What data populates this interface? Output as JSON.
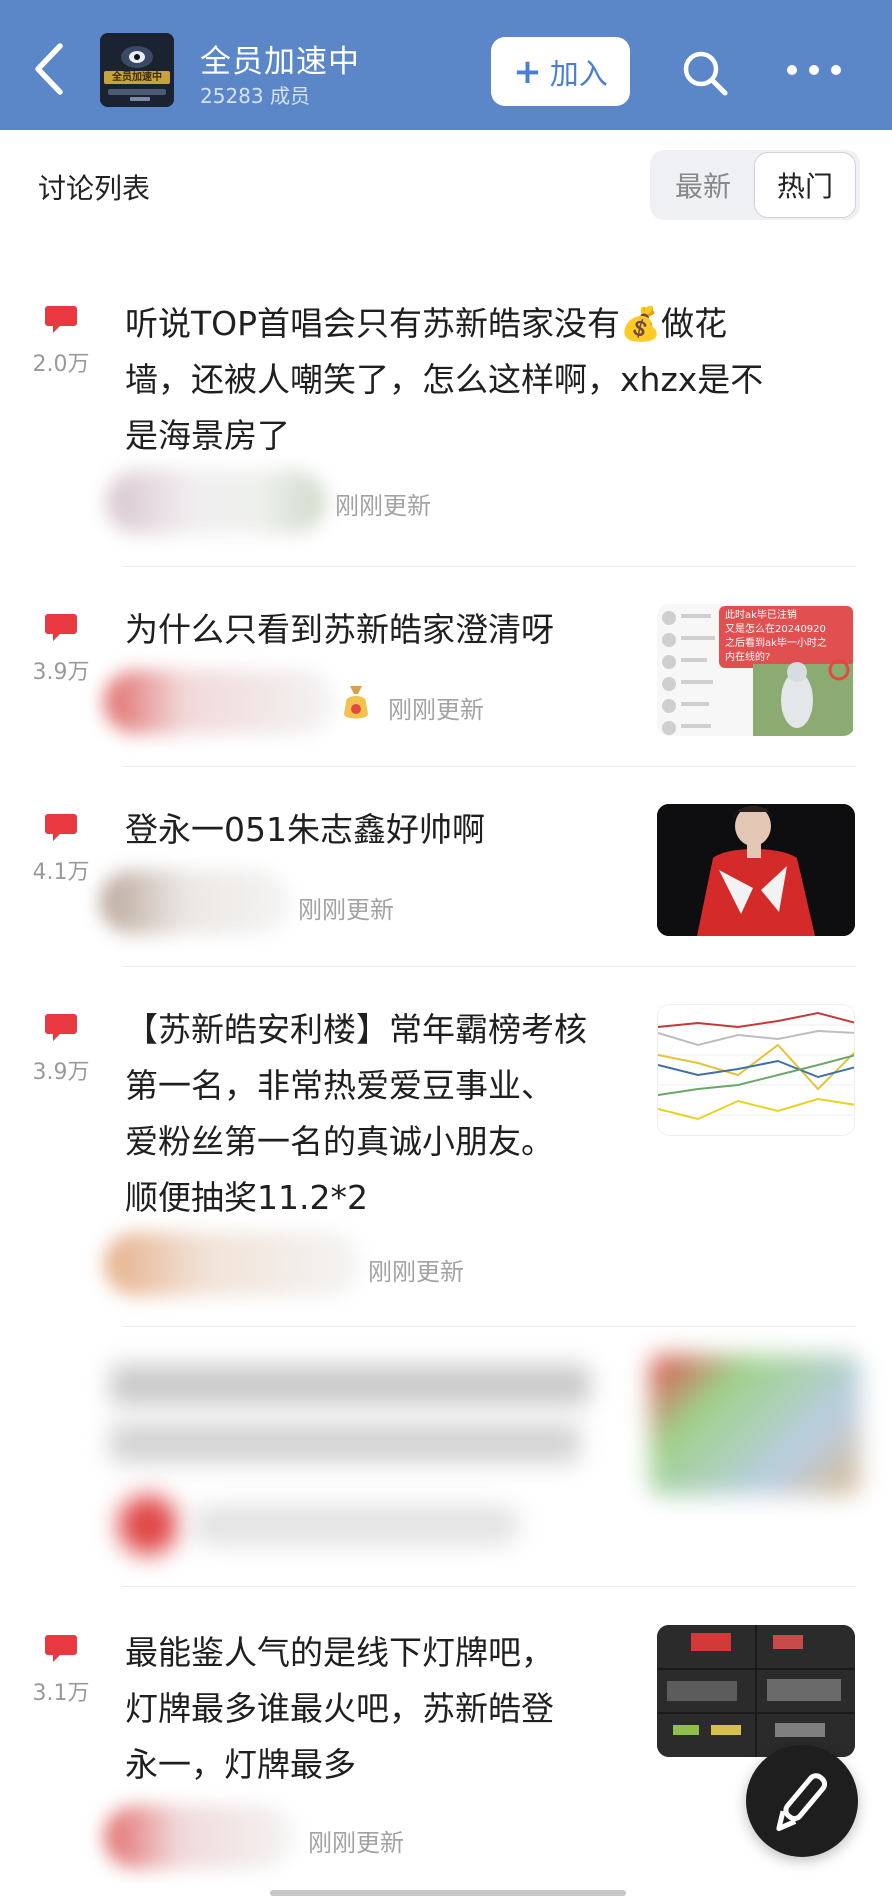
{
  "header": {
    "group_name": "全员加速中",
    "member_count": "25283 成员",
    "join_label": "加入",
    "join_plus": "+",
    "avatar_text": "全员加速中"
  },
  "list": {
    "title": "讨论列表",
    "sort_latest": "最新",
    "sort_hot": "热门"
  },
  "posts": [
    {
      "heat": "2.0万",
      "title_lines": [
        "听说TOP首唱会只有苏新皓家没有💰做花",
        "墙，还被人嘲笑了，怎么这样啊，xhzx是不",
        "是海景房了"
      ],
      "update": "刚刚更新"
    },
    {
      "heat": "3.9万",
      "title_lines": [
        "为什么只看到苏新皓家澄清呀"
      ],
      "update": "刚刚更新"
    },
    {
      "heat": "4.1万",
      "title_lines": [
        "登永一051朱志鑫好帅啊"
      ],
      "update": "刚刚更新"
    },
    {
      "heat": "3.9万",
      "title_lines": [
        "【苏新皓安利楼】常年霸榜考核",
        "第一名，非常热爱爱豆事业、",
        "爱粉丝第一名的真诚小朋友。",
        "顺便抽奖11.2*2"
      ],
      "update": "刚刚更新"
    },
    {
      "heat": "3.1万",
      "title_lines": [
        "最能鉴人气的是线下灯牌吧，",
        "灯牌最多谁最火吧，苏新皓登",
        "永一，灯牌最多"
      ],
      "update": "刚刚更新"
    }
  ],
  "thumb_texts": {
    "post2": [
      "此时ak毕已注销",
      "又是怎么在20240920",
      "之后看到ak毕一小时之",
      "内在线的?"
    ]
  },
  "colors": {
    "header_bg": "#5b86c8",
    "join_text": "#4a7fd0",
    "heat_icon": "#e9383f",
    "fab_bg": "#1e1e1e"
  },
  "icons": {
    "back": "chevron-left-icon",
    "search": "search-icon",
    "more": "more-dots-icon",
    "heat": "chat-bubble-icon",
    "fab": "pen-icon"
  }
}
